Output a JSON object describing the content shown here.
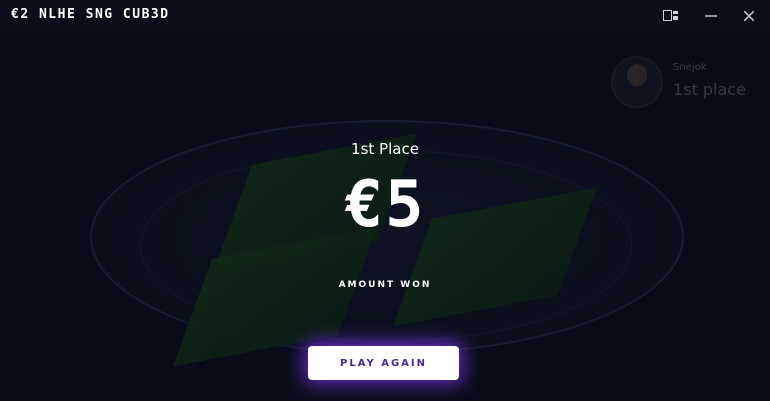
{
  "window": {
    "title": "€2 NLHE SNG CUB3D",
    "controls": {
      "snap_icon": "window-snap-icon",
      "minimize_icon": "minimize-icon",
      "close_icon": "close-icon"
    }
  },
  "player": {
    "name": "Snejok",
    "place": "1st place",
    "avatar_icon": "avatar-icon"
  },
  "result": {
    "heading": "1st Place",
    "amount": "€5",
    "amount_label": "AMOUNT WON"
  },
  "actions": {
    "play_again_label": "PLAY AGAIN"
  },
  "colors": {
    "background": "#0b0f1d",
    "felt": "#163a1a",
    "button_glow": "#823cff",
    "button_text": "#4a2a9a"
  }
}
